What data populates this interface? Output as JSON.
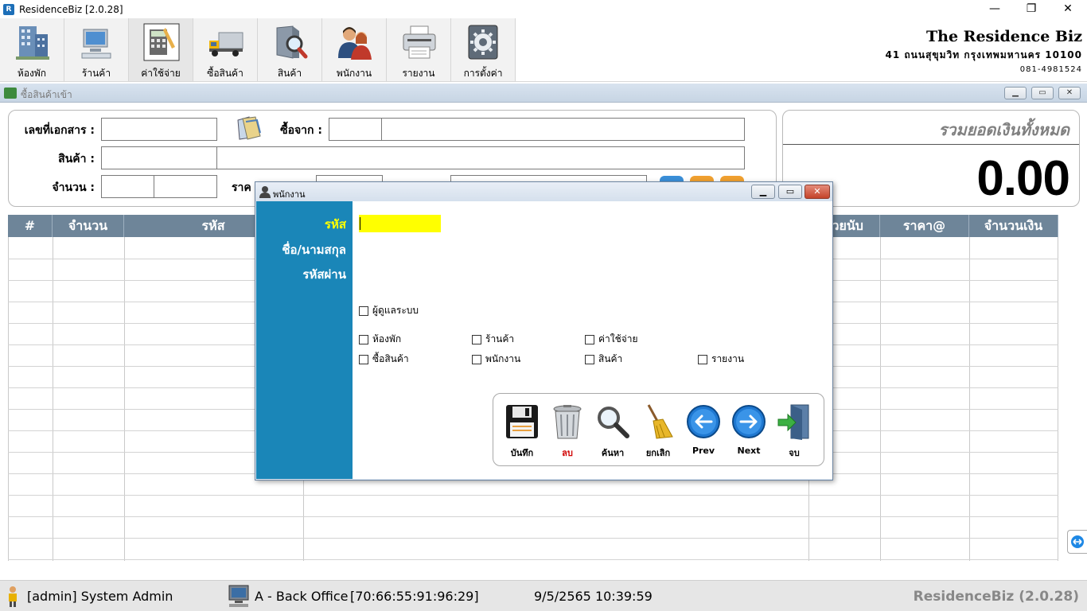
{
  "app": {
    "title": "ResidenceBiz [2.0.28]",
    "window_controls": {
      "minimize": "—",
      "maximize": "❐",
      "close": "✕"
    }
  },
  "toolbar": {
    "items": [
      {
        "label": "ห้องพัก",
        "icon": "building-icon"
      },
      {
        "label": "ร้านค้า",
        "icon": "computer-icon"
      },
      {
        "label": "ค่าใช้จ่าย",
        "icon": "calculator-icon"
      },
      {
        "label": "ซื้อสินค้า",
        "icon": "truck-icon"
      },
      {
        "label": "สินค้า",
        "icon": "product-search-icon"
      },
      {
        "label": "พนักงาน",
        "icon": "employees-icon"
      },
      {
        "label": "รายงาน",
        "icon": "printer-icon"
      },
      {
        "label": "การตั้งค่า",
        "icon": "settings-gear-icon"
      }
    ]
  },
  "company": {
    "name": "The Residence Biz",
    "address": "41 ถนนสุขุมวิท กรุงเทพมหานคร 10100",
    "phone": "081-4981524"
  },
  "purchase_window": {
    "title": "ซื้อสินค้าเข้า",
    "controls": {
      "minimize": "▁",
      "maximize": "▭",
      "close": "✕"
    },
    "form": {
      "doc_no_label": "เลขที่เอกสาร :",
      "supplier_label": "ซื้อจาก :",
      "product_label": "สินค้า :",
      "qty_label": "จำนวน :",
      "price_label": "ราค"
    },
    "total": {
      "label": "รวมยอดเงินทั้งหมด",
      "value": "0.00"
    },
    "grid": {
      "columns": [
        "#",
        "จำนวน",
        "รหัส",
        "",
        "ย่วยนับ",
        "ราคา@",
        "จำนวนเงิน"
      ]
    }
  },
  "employee_dialog": {
    "title": "พนักงาน",
    "controls": {
      "minimize": "▁",
      "maximize": "▭",
      "close": "✕"
    },
    "fields": {
      "code_label": "รหัส",
      "name_label": "ชื่อ/นามสกุล",
      "password_label": "รหัสผ่าน"
    },
    "checkboxes": {
      "admin": "ผู้ดูแลระบบ",
      "rooms": "ห้องพัก",
      "shop": "ร้านค้า",
      "expenses": "ค่าใช้จ่าย",
      "purchase": "ซื้อสินค้า",
      "employees": "พนักงาน",
      "products": "สินค้า",
      "reports": "รายงาน"
    },
    "actions": {
      "save": "บันทึก",
      "delete": "ลบ",
      "search": "ค้นหา",
      "cancel": "ยกเลิก",
      "prev": "Prev",
      "next": "Next",
      "exit": "จบ"
    }
  },
  "statusbar": {
    "user": "[admin] System Admin",
    "terminal": "A - Back Office",
    "mac": "[70:66:55:91:96:29]",
    "datetime": "9/5/2565 10:39:59",
    "brand": "ResidenceBiz (2.0.28)"
  }
}
